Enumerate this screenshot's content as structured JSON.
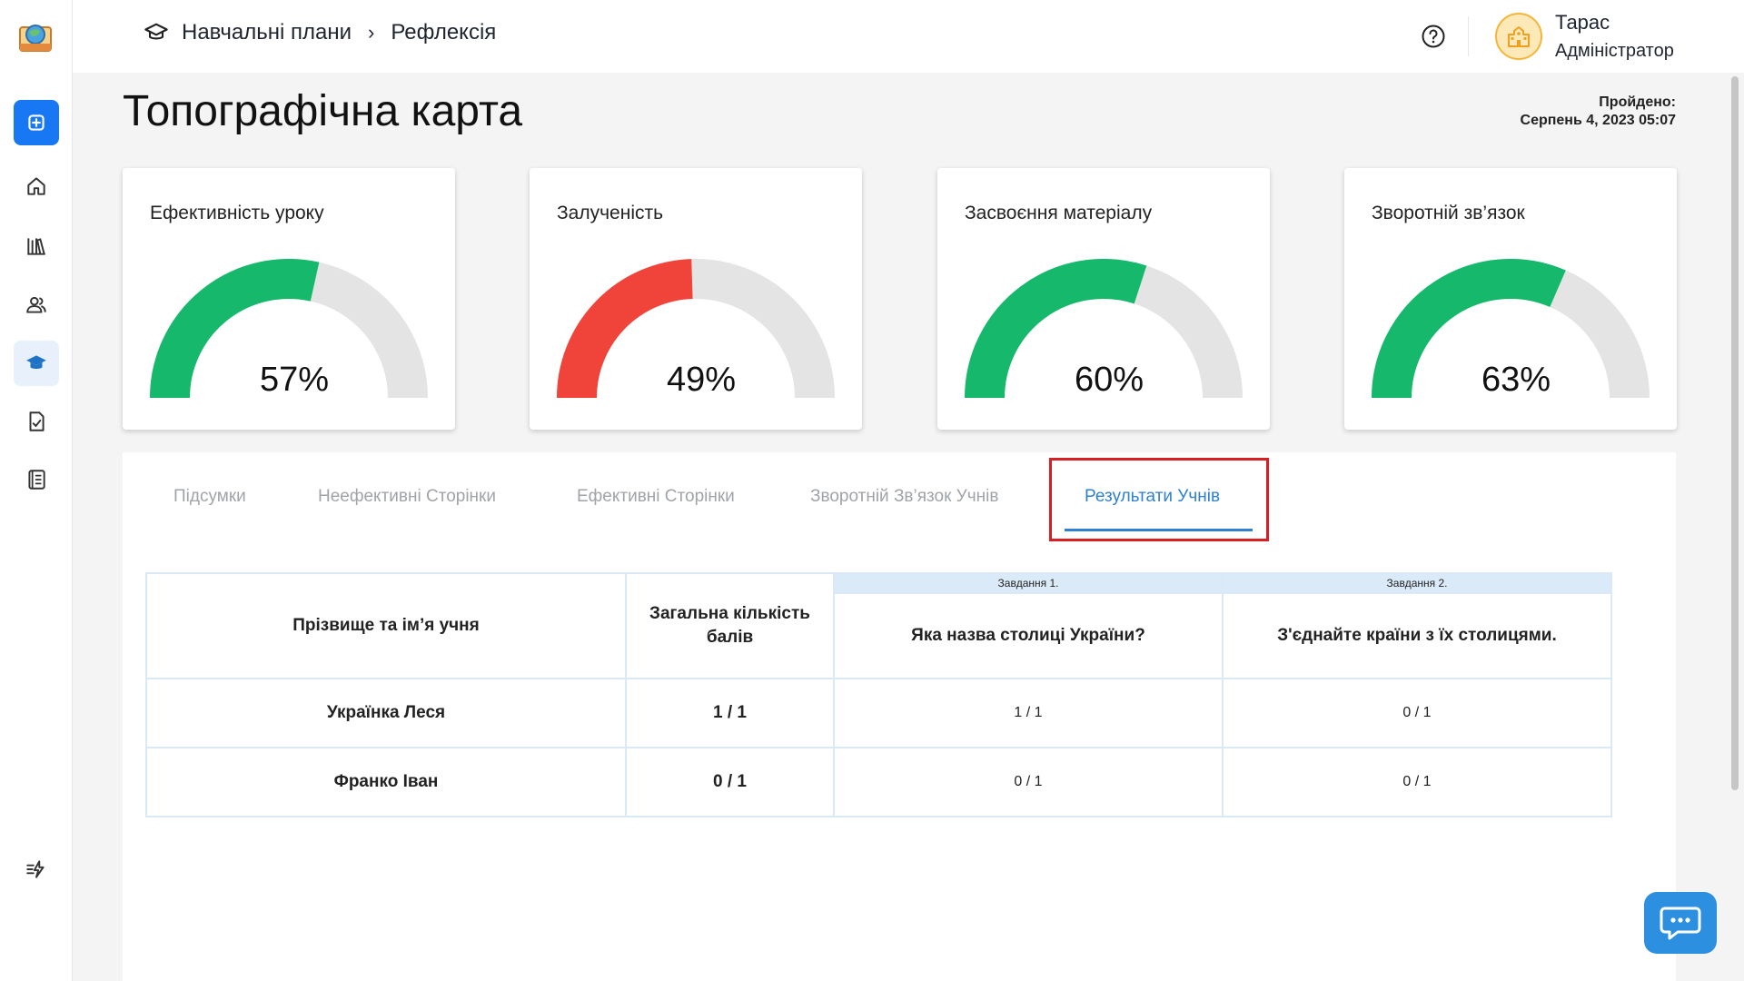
{
  "header": {
    "breadcrumb": [
      "Навчальні плани",
      "Рефлексія"
    ],
    "breadcrumb_separator": "›",
    "user": {
      "name": "Тарас",
      "role": "Адміністратор"
    }
  },
  "page": {
    "title": "Топографічна карта",
    "passed_label": "Пройдено:",
    "passed_date": "Серпень 4, 2023 05:07"
  },
  "metrics": [
    {
      "title": "Ефективність уроку",
      "value": 57,
      "label": "57%",
      "color": "#16b86b"
    },
    {
      "title": "Залученість",
      "value": 49,
      "label": "49%",
      "color": "#f0433a"
    },
    {
      "title": "Засвоєння матеріалу",
      "value": 60,
      "label": "60%",
      "color": "#16b86b"
    },
    {
      "title": "Зворотній зв’язок",
      "value": 63,
      "label": "63%",
      "color": "#16b86b"
    }
  ],
  "tabs": [
    {
      "label": "Підсумки",
      "active": false
    },
    {
      "label": "Неефективні Сторінки",
      "active": false
    },
    {
      "label": "Ефективні Сторінки",
      "active": false
    },
    {
      "label": "Зворотній Зв’язок Учнів",
      "active": false
    },
    {
      "label": "Результати Учнів",
      "active": true
    }
  ],
  "table": {
    "col_name": "Прізвище та ім’я учня",
    "col_total": "Загальна кількість балів",
    "tasks": [
      {
        "header": "Завдання 1.",
        "question": "Яка назва столиці України?"
      },
      {
        "header": "Завдання 2.",
        "question": "З'єднайте країни з їх столицями."
      }
    ],
    "rows": [
      {
        "name": "Українка Леся",
        "total": "1 / 1",
        "scores": [
          "1 / 1",
          "0 / 1"
        ]
      },
      {
        "name": "Франко Іван",
        "total": "0 / 1",
        "scores": [
          "0 / 1",
          "0 / 1"
        ]
      }
    ]
  },
  "colors": {
    "accent": "#2f80d1",
    "primary_button": "#1877f2",
    "gauge_track": "#e4e4e4",
    "highlight": "#d91f26"
  }
}
